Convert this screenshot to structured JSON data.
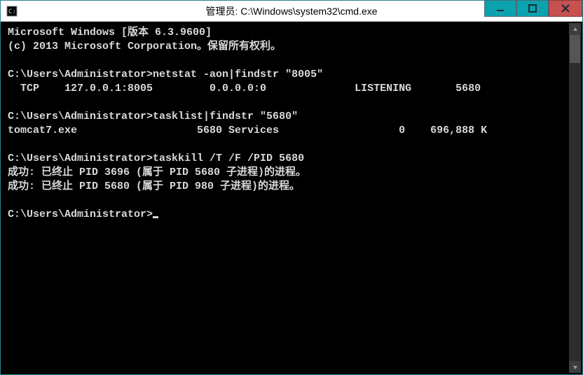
{
  "window": {
    "title": "管理员: C:\\Windows\\system32\\cmd.exe"
  },
  "controls": {
    "minimize": "minimize",
    "maximize": "maximize",
    "close": "close"
  },
  "terminal": {
    "line01": "Microsoft Windows [版本 6.3.9600]",
    "line02": "(c) 2013 Microsoft Corporation。保留所有权利。",
    "line03": "",
    "line04": "C:\\Users\\Administrator>netstat -aon|findstr \"8005\"",
    "line05": "  TCP    127.0.0.1:8005         0.0.0.0:0              LISTENING       5680",
    "line06": "",
    "line07": "C:\\Users\\Administrator>tasklist|findstr \"5680\"",
    "line08": "tomcat7.exe                   5680 Services                   0    696,888 K",
    "line09": "",
    "line10": "C:\\Users\\Administrator>taskkill /T /F /PID 5680",
    "line11": "成功: 已终止 PID 3696 (属于 PID 5680 子进程)的进程。",
    "line12": "成功: 已终止 PID 5680 (属于 PID 980 子进程)的进程。",
    "line13": "",
    "line14_prompt": "C:\\Users\\Administrator>"
  }
}
